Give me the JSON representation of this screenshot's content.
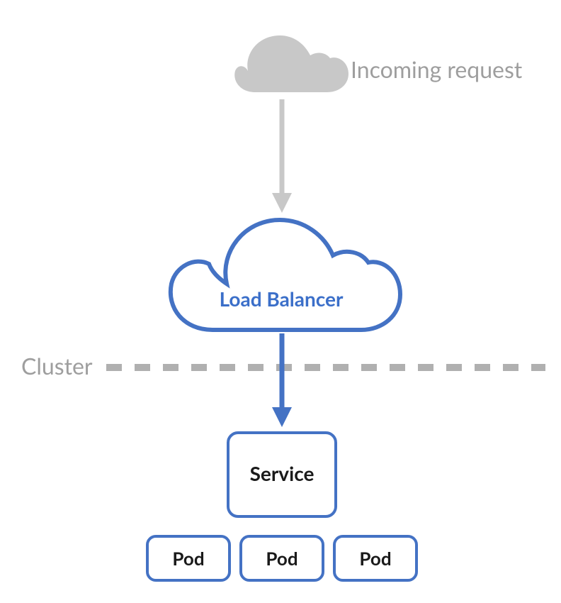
{
  "labels": {
    "incoming": "Incoming request",
    "loadBalancer": "Load Balancer",
    "cluster": "Cluster",
    "service": "Service",
    "pod1": "Pod",
    "pod2": "Pod",
    "pod3": "Pod"
  },
  "colors": {
    "gray": "#c8c8c8",
    "grayText": "#9e9e9e",
    "blue": "#4472c4",
    "blueStroke": "#3b6fc9",
    "black": "#1a1a1a"
  }
}
